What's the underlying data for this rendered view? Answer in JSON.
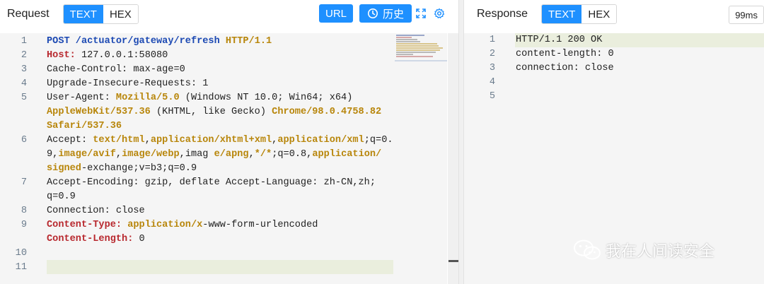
{
  "request": {
    "title": "Request",
    "modes": [
      "TEXT",
      "HEX"
    ],
    "active_mode": "TEXT",
    "url_button": "URL",
    "history_button": "历史",
    "lines": [
      {
        "n": "1",
        "parts": [
          [
            "m",
            "POST "
          ],
          [
            "m",
            "/actuator/gateway/refresh "
          ],
          [
            "k",
            "HTTP/1.1"
          ]
        ]
      },
      {
        "n": "2",
        "parts": [
          [
            "kr",
            "Host:"
          ],
          [
            "t",
            " 127.0.0.1:58080"
          ]
        ]
      },
      {
        "n": "3",
        "parts": [
          [
            "t",
            "Cache-Control: max-age=0"
          ]
        ]
      },
      {
        "n": "4",
        "parts": [
          [
            "t",
            "Upgrade-Insecure-Requests: 1"
          ]
        ]
      },
      {
        "n": "5",
        "parts": [
          [
            "t",
            "User-Agent: "
          ],
          [
            "k",
            "Mozilla/5.0"
          ],
          [
            "t",
            " (Windows NT 10.0; Win64; x64)"
          ]
        ]
      },
      {
        "n": "",
        "parts": [
          [
            "k",
            "AppleWebKit/537.36"
          ],
          [
            "t",
            " (KHTML, like Gecko) "
          ],
          [
            "k",
            "Chrome/98.0.4758.82"
          ]
        ]
      },
      {
        "n": "",
        "parts": [
          [
            "k",
            "Safari/537.36"
          ]
        ]
      },
      {
        "n": "6",
        "parts": [
          [
            "t",
            "Accept: "
          ],
          [
            "k",
            "text/html"
          ],
          [
            "t",
            ","
          ],
          [
            "k",
            "application/xhtml+xml"
          ],
          [
            "t",
            ","
          ],
          [
            "k",
            "application/xml"
          ],
          [
            "t",
            ";q=0."
          ]
        ]
      },
      {
        "n": "",
        "parts": [
          [
            "t",
            "9,"
          ],
          [
            "k",
            "image/avif"
          ],
          [
            "t",
            ","
          ],
          [
            "k",
            "image/webp"
          ],
          [
            "t",
            ",imag "
          ],
          [
            "k",
            "e/apng"
          ],
          [
            "t",
            ","
          ],
          [
            "k",
            "*/*"
          ],
          [
            "t",
            ";q=0.8,"
          ],
          [
            "k",
            "application/"
          ]
        ]
      },
      {
        "n": "",
        "parts": [
          [
            "k",
            "signed"
          ],
          [
            "t",
            "-exchange;v=b3;q=0.9"
          ]
        ]
      },
      {
        "n": "7",
        "parts": [
          [
            "t",
            "Accept-Encoding: gzip, deflate Accept-Language: zh-CN,zh;"
          ]
        ]
      },
      {
        "n": "",
        "parts": [
          [
            "t",
            "q=0.9"
          ]
        ]
      },
      {
        "n": "8",
        "parts": [
          [
            "t",
            "Connection: close"
          ]
        ]
      },
      {
        "n": "9",
        "parts": [
          [
            "kr",
            "Content-Type: "
          ],
          [
            "k",
            "application/x"
          ],
          [
            "t",
            "-www-form-urlencoded"
          ]
        ]
      },
      {
        "n": "",
        "parts": [
          [
            "kr",
            "Content-Length:"
          ],
          [
            "t",
            " 0"
          ]
        ]
      },
      {
        "n": "10",
        "parts": []
      },
      {
        "n": "11",
        "parts": []
      }
    ]
  },
  "response": {
    "title": "Response",
    "modes": [
      "TEXT",
      "HEX"
    ],
    "active_mode": "TEXT",
    "timing": "99ms",
    "lines": [
      {
        "n": "1",
        "text": "HTTP/1.1 200 OK"
      },
      {
        "n": "2",
        "text": "content-length: 0"
      },
      {
        "n": "3",
        "text": "connection: close"
      },
      {
        "n": "4",
        "text": ""
      },
      {
        "n": "5",
        "text": ""
      }
    ]
  },
  "watermark": "我在人间读安全",
  "icons": {
    "history": "clock-icon",
    "expand": "expand-icon",
    "settings": "gear-icon",
    "watermark": "wechat-icon"
  },
  "colors": {
    "accent": "#1e90ff",
    "keyword": "#b8860b",
    "header_key": "#b8282e",
    "method": "#1c49b3"
  }
}
